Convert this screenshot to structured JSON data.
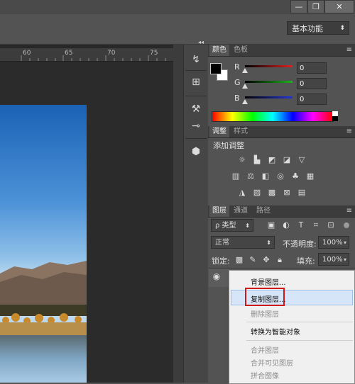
{
  "window": {
    "minimize_icon": "minimize-icon",
    "restore_icon": "restore-icon",
    "close_icon": "close-icon"
  },
  "options_bar": {
    "workspace": "基本功能"
  },
  "ruler": {
    "ticks": [
      "60",
      "65",
      "70",
      "75"
    ]
  },
  "color_panel": {
    "tabs": [
      "颜色",
      "色板"
    ],
    "r_label": "R",
    "g_label": "G",
    "b_label": "B",
    "r_value": "0",
    "g_value": "0",
    "b_value": "0",
    "colors": {
      "r": "#e02020",
      "g": "#1cb31c",
      "b": "#2434d8"
    }
  },
  "adjustments_panel": {
    "tabs": [
      "调整",
      "样式"
    ],
    "title": "添加调整"
  },
  "layers_panel": {
    "tabs": [
      "图层",
      "通道",
      "路径"
    ],
    "filter_type": "ρ 类型",
    "blend_mode": "正常",
    "opacity_label": "不透明度:",
    "opacity_value": "100%",
    "lock_label": "锁定:",
    "fill_label": "填充:",
    "fill_value": "100%"
  },
  "context_menu": {
    "items": [
      {
        "label": "背景图层...",
        "disabled": false
      },
      {
        "label": "复制图层...",
        "disabled": false,
        "highlighted": true
      },
      {
        "label": "删除图层",
        "disabled": true
      },
      {
        "label": "转换为智能对象",
        "disabled": false
      },
      {
        "label": "合并图层",
        "disabled": true
      },
      {
        "label": "合并可见图层",
        "disabled": true
      },
      {
        "label": "拼合图像",
        "disabled": true
      }
    ]
  },
  "accent": {
    "highlight_box": "#d01818",
    "menu_hover": "#d6e6f8"
  }
}
